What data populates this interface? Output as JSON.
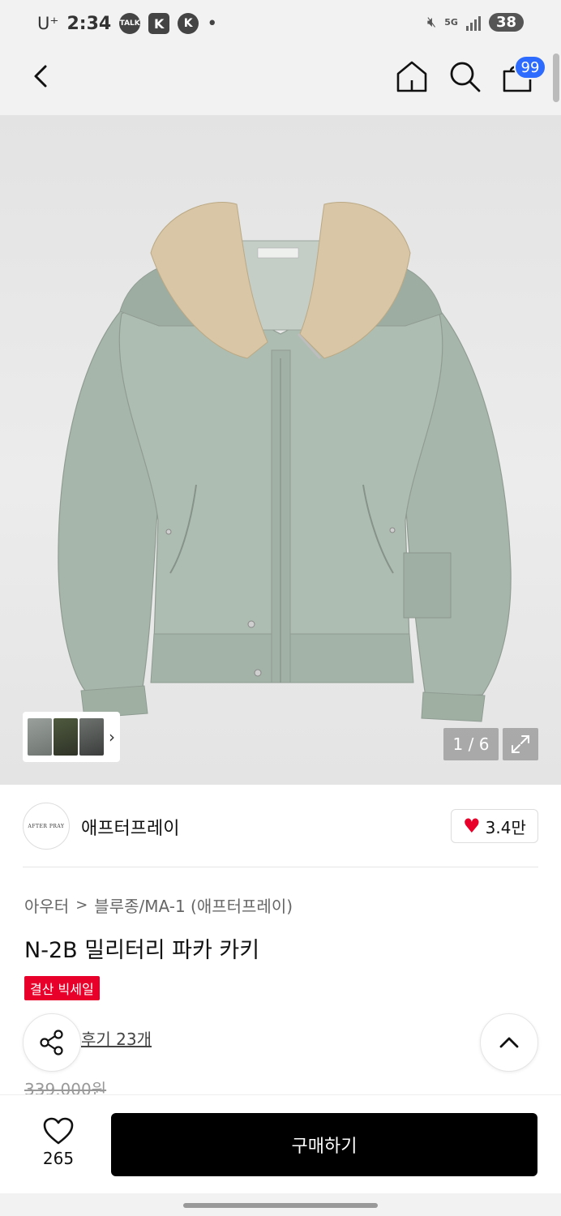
{
  "status_bar": {
    "carrier": "U⁺",
    "time": "2:34",
    "icon_talk": "TALK",
    "network": "5G",
    "battery": "38"
  },
  "icons": {
    "back": "chevron-left-icon",
    "home": "home-icon",
    "search": "search-icon",
    "cart": "shopping-bag-icon",
    "share": "share-icon",
    "scroll_top": "chevron-up-icon",
    "heart": "heart-icon",
    "expand": "expand-icon"
  },
  "header": {
    "cart_badge": "99"
  },
  "gallery": {
    "page_counter": "1 / 6",
    "thumbnail_more": "›"
  },
  "brand": {
    "logo_text": "AFTER PRAY",
    "name": "애프터프레이",
    "like_count": "3.4만",
    "like_color": "#e8002a"
  },
  "product": {
    "breadcrumb": [
      "아우터",
      "블루종/MA-1 (애프터프레이)"
    ],
    "breadcrumb_separator": ">",
    "title": "N-2B 밀리터리 파카 카키",
    "sale_badge": "결산 빅세일",
    "sale_color": "#e8002a",
    "reviews": "후기 23개",
    "original_price": "339,000원"
  },
  "bottom_bar": {
    "wish_count": "265",
    "buy_label": "구매하기"
  },
  "colors": {
    "accent_blue": "#2d6bff",
    "buy_button": "#000000",
    "jacket": "#a9b8ac",
    "collar": "#d9c8a9"
  }
}
